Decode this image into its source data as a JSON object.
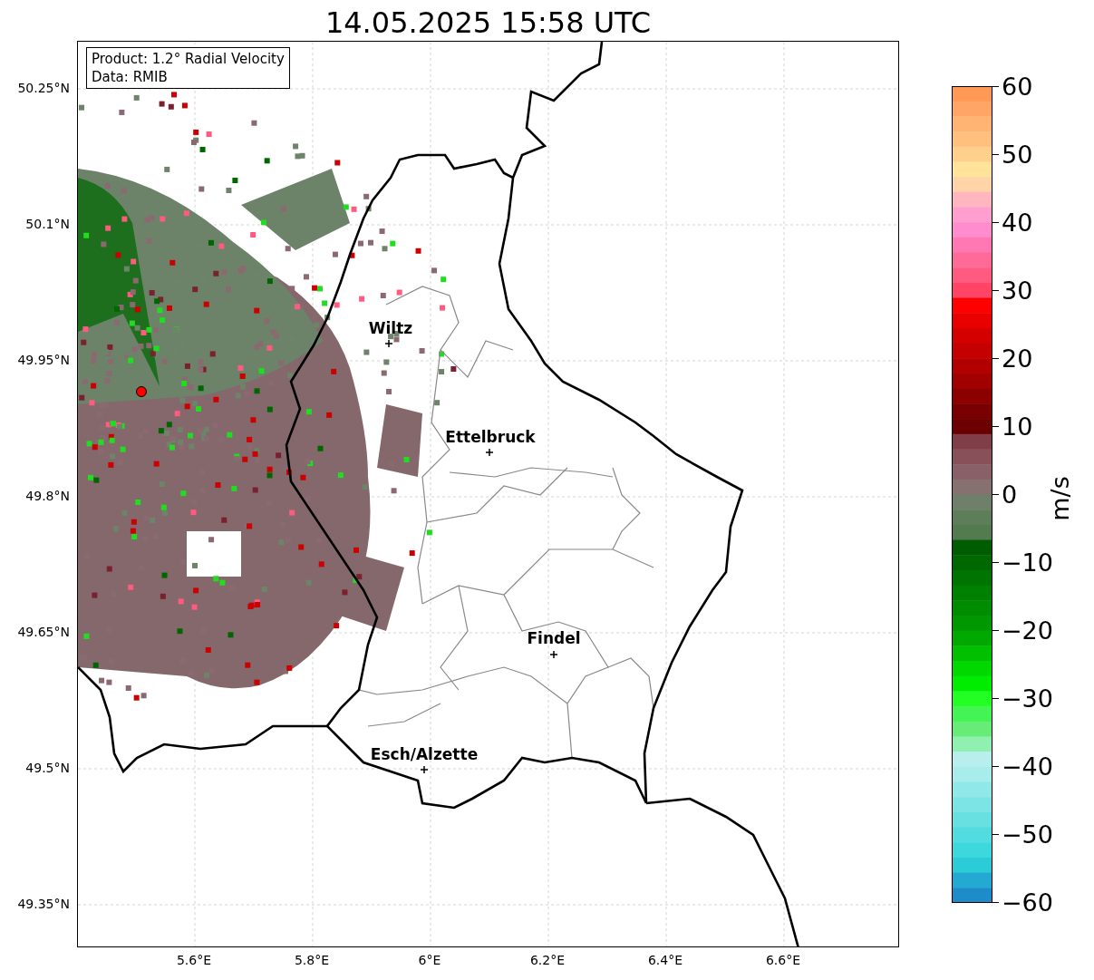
{
  "title": "14.05.2025 15:58 UTC",
  "info_box": {
    "lines": [
      "Product: 1.2° Radial Velocity",
      "Data: RMIB"
    ]
  },
  "lat_ticks": [
    "50.25°N",
    "50.1°N",
    "49.95°N",
    "49.8°N",
    "49.65°N",
    "49.5°N",
    "49.35°N"
  ],
  "lon_ticks": [
    "5.6°E",
    "5.8°E",
    "6°E",
    "6.2°E",
    "6.4°E",
    "6.6°E"
  ],
  "cities": [
    {
      "name": "Wiltz",
      "kind": "upper"
    },
    {
      "name": "Ettelbruck",
      "kind": "upper"
    },
    {
      "name": "Findel",
      "kind": "upper"
    },
    {
      "name": "Esch/Alzette",
      "kind": "upper"
    }
  ],
  "colorbar": {
    "label": "m/s",
    "ticks": [
      "60",
      "50",
      "40",
      "30",
      "20",
      "10",
      "0",
      "−10",
      "−20",
      "−30",
      "−40",
      "−50",
      "−60"
    ]
  }
}
